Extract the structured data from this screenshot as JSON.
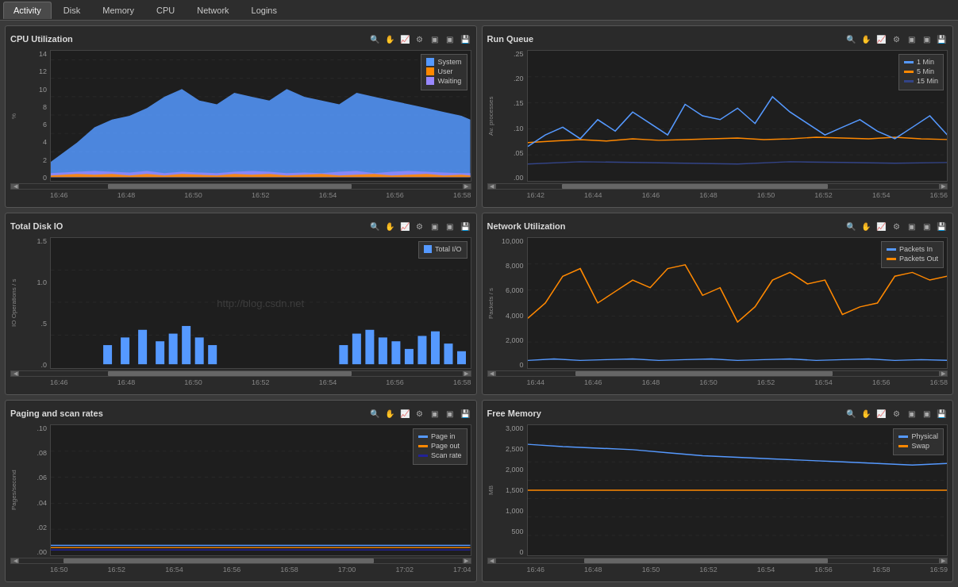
{
  "tabs": [
    {
      "id": "activity",
      "label": "Activity",
      "active": true
    },
    {
      "id": "disk",
      "label": "Disk",
      "active": false
    },
    {
      "id": "memory",
      "label": "Memory",
      "active": false
    },
    {
      "id": "cpu",
      "label": "CPU",
      "active": false
    },
    {
      "id": "network",
      "label": "Network",
      "active": false
    },
    {
      "id": "logins",
      "label": "Logins",
      "active": false
    }
  ],
  "panels": {
    "cpu_util": {
      "title": "CPU Utilization",
      "y_label": "%",
      "y_ticks": [
        "14",
        "12",
        "10",
        "8",
        "6",
        "4",
        "2",
        "0"
      ],
      "x_ticks": [
        "16:46",
        "16:48",
        "16:50",
        "16:52",
        "16:54",
        "16:56",
        "16:58"
      ],
      "legend": [
        {
          "label": "System",
          "color": "#5599ff",
          "type": "rect"
        },
        {
          "label": "User",
          "color": "#ff8800",
          "type": "rect"
        },
        {
          "label": "Waiting",
          "color": "#aaaaff",
          "type": "rect"
        }
      ]
    },
    "run_queue": {
      "title": "Run Queue",
      "y_label": "Av. processes",
      "y_ticks": [
        ".25",
        ".20",
        ".15",
        ".10",
        ".05",
        ".00"
      ],
      "x_ticks": [
        "16:42",
        "16:44",
        "16:46",
        "16:48",
        "16:50",
        "16:52",
        "16:54",
        "16:56"
      ],
      "legend": [
        {
          "label": "1 Min",
          "color": "#5599ff",
          "type": "line"
        },
        {
          "label": "5 Min",
          "color": "#ff8800",
          "type": "line"
        },
        {
          "label": "15 Min",
          "color": "#4455aa",
          "type": "line"
        }
      ]
    },
    "disk_io": {
      "title": "Total Disk IO",
      "y_label": "IO Operations / s",
      "y_ticks": [
        "1.5",
        "1.0",
        ".5",
        ".0"
      ],
      "x_ticks": [
        "16:46",
        "16:48",
        "16:50",
        "16:52",
        "16:54",
        "16:56",
        "16:58"
      ],
      "legend": [
        {
          "label": "Total I/O",
          "color": "#5599ff",
          "type": "rect"
        }
      ],
      "watermark": "http://blog.csdn.net"
    },
    "net_util": {
      "title": "Network Utilization",
      "y_label": "Packets / s",
      "y_ticks": [
        "10,000",
        "8,000",
        "6,000",
        "4,000",
        "2,000",
        "0"
      ],
      "x_ticks": [
        "16:44",
        "16:46",
        "16:48",
        "16:50",
        "16:52",
        "16:54",
        "16:56",
        "16:58"
      ],
      "legend": [
        {
          "label": "Packets In",
          "color": "#5599ff",
          "type": "line"
        },
        {
          "label": "Packets Out",
          "color": "#ff8800",
          "type": "line"
        }
      ]
    },
    "paging": {
      "title": "Paging and scan rates",
      "y_label": "Pages/second",
      "y_ticks": [
        ".10",
        ".08",
        ".06",
        ".04",
        ".02",
        ".00"
      ],
      "x_ticks": [
        "16:50",
        "16:52",
        "16:54",
        "16:56",
        "16:58",
        "17:00",
        "17:02",
        "17:04"
      ],
      "legend": [
        {
          "label": "Page in",
          "color": "#5599ff",
          "type": "line"
        },
        {
          "label": "Page out",
          "color": "#ff8800",
          "type": "line"
        },
        {
          "label": "Scan rate",
          "color": "#222299",
          "type": "line"
        }
      ]
    },
    "free_mem": {
      "title": "Free Memory",
      "y_label": "MB",
      "y_ticks": [
        "3,000",
        "2,500",
        "2,000",
        "1,500",
        "1,000",
        "500",
        "0"
      ],
      "x_ticks": [
        "16:46",
        "16:48",
        "16:50",
        "16:52",
        "16:54",
        "16:56",
        "16:58",
        "16:59"
      ],
      "legend": [
        {
          "label": "Physical",
          "color": "#5599ff",
          "type": "line"
        },
        {
          "label": "Swap",
          "color": "#ff8800",
          "type": "line"
        }
      ]
    }
  },
  "icons": {
    "zoom": "🔍",
    "hand": "✋",
    "chart": "📈",
    "settings": "⚙",
    "square1": "□",
    "square2": "□",
    "save": "💾",
    "arrow_left": "◀",
    "arrow_right": "▶"
  }
}
